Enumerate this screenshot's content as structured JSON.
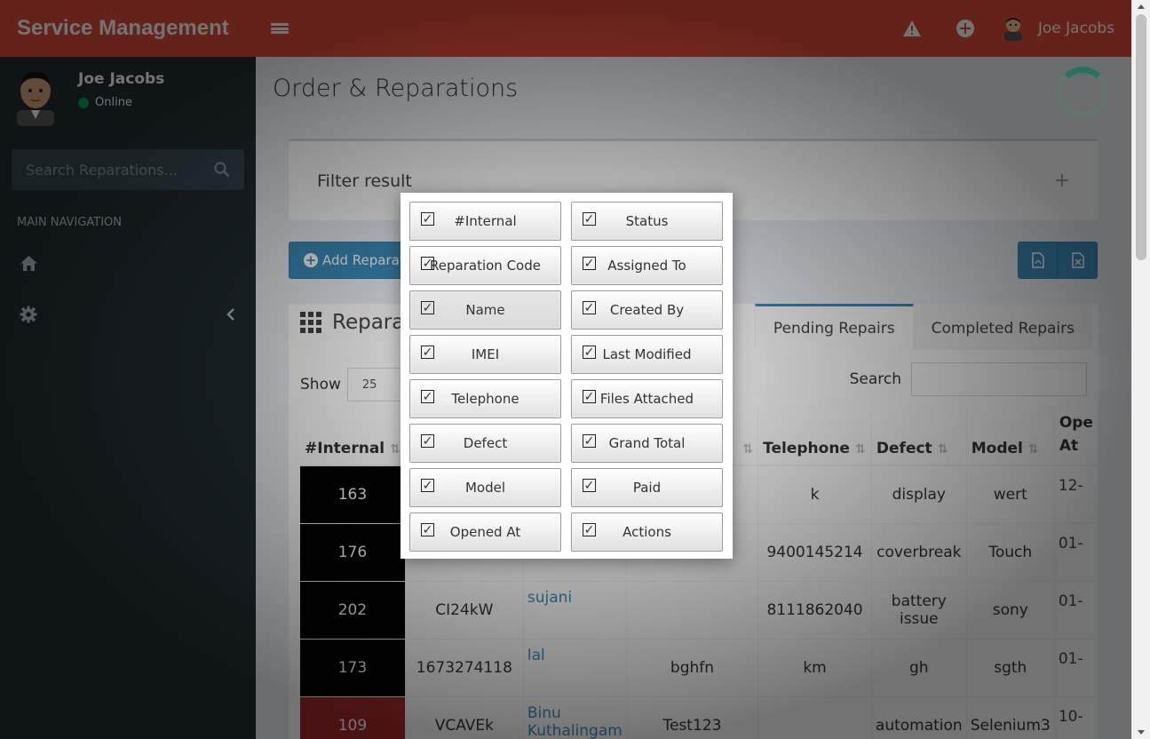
{
  "header": {
    "logo": "Service Management",
    "user_name": "Joe Jacobs"
  },
  "sidebar": {
    "user_name": "Joe Jacobs",
    "status": "Online",
    "search_placeholder": "Search Reparations...",
    "nav_header": "MAIN NAVIGATION"
  },
  "page": {
    "title": "Order & Reparations",
    "filter_title": "Filter result",
    "filter_toggle": "+",
    "add_button": "Add Reparat",
    "table_title": "Repara",
    "tabs": [
      "Pending Repairs",
      "Completed Repairs"
    ],
    "show_label": "Show",
    "show_value": "25",
    "search_label": "Search"
  },
  "table": {
    "columns": [
      "#Internal",
      "",
      "",
      "",
      "Telephone",
      "Defect",
      "Model",
      "Ope At"
    ],
    "rows": [
      {
        "internal": "163",
        "code": "",
        "name": "",
        "imei": "",
        "telephone": "k",
        "defect": "display",
        "model": "wert",
        "opened": "12-",
        "color": "black"
      },
      {
        "internal": "176",
        "code": "",
        "name": "",
        "imei": "",
        "telephone": "9400145214",
        "defect": "coverbreak",
        "model": "Touch",
        "opened": "01-",
        "color": "black"
      },
      {
        "internal": "202",
        "code": "CI24kW",
        "name": "sujani",
        "imei": "",
        "telephone": "8111862040",
        "defect": "battery issue",
        "model": "sony",
        "opened": "01-",
        "color": "black"
      },
      {
        "internal": "173",
        "code": "1673274118",
        "name": "lal",
        "imei": "bghfn",
        "telephone": "km",
        "defect": "gh",
        "model": "sgth",
        "opened": "01-",
        "color": "black"
      },
      {
        "internal": "109",
        "code": "VCAVEk",
        "name": "Binu Kuthalingam",
        "imei": "Test123",
        "telephone": "",
        "defect": "automation",
        "model": "Selenium3",
        "opened": "10-",
        "color": "red"
      }
    ]
  },
  "column_toggles": [
    {
      "label": "#Internal",
      "checked": true
    },
    {
      "label": "Status",
      "checked": true
    },
    {
      "label": "Reparation Code",
      "checked": true
    },
    {
      "label": "Assigned To",
      "checked": true
    },
    {
      "label": "Name",
      "checked": true
    },
    {
      "label": "Created By",
      "checked": true
    },
    {
      "label": "IMEI",
      "checked": true
    },
    {
      "label": "Last Modified",
      "checked": true
    },
    {
      "label": "Telephone",
      "checked": true
    },
    {
      "label": "Files Attached",
      "checked": true
    },
    {
      "label": "Defect",
      "checked": true
    },
    {
      "label": "Grand Total",
      "checked": true
    },
    {
      "label": "Model",
      "checked": true
    },
    {
      "label": "Paid",
      "checked": true
    },
    {
      "label": "Opened At",
      "checked": true
    },
    {
      "label": "Actions",
      "checked": true
    }
  ],
  "colors": {
    "header": "#dd4b39",
    "sidebar": "#222d32",
    "primary": "#3c8dbc",
    "online": "#00a65a"
  }
}
